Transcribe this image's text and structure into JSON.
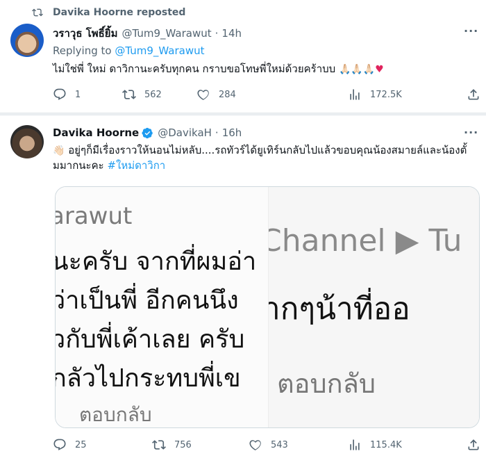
{
  "retweet_tweet": {
    "repost_label": "Davika Hoorne reposted",
    "author_name": "วราวุธ โพธิ์ยิ้ม",
    "author_handle": "@Tum9_Warawut",
    "time": "14h",
    "replying_prefix": "Replying to",
    "replying_handle": "@Tum9_Warawut",
    "text": "ไม่ใช่พี่ ใหม่ ดาวิกานะครับทุกคน กราบขอโทษพี่ใหม่ด้วยคร้าบบ",
    "emoji_hands": "🙏🏻🙏🏻🙏🏻",
    "emoji_heart": "♥",
    "stats": {
      "replies": "1",
      "reposts": "562",
      "likes": "284",
      "views": "172.5K"
    }
  },
  "main_tweet": {
    "author_name": "Davika Hoorne",
    "author_handle": "@DavikaH",
    "time": "16h",
    "emoji_lead": "👋🏻",
    "text": "อยู่ๆก็มีเรื่องราวให้นอนไม่หลับ....รถทัวร์ได้ยูเทิร์นกลับไปแล้วขอบคุณน้องสมายล์และน้องตั้มมากนะคะ",
    "hashtag": "#ใหม่ดาวิกา",
    "media_left": {
      "username": "arawut",
      "line1": "นะครับ จากที่ผมอ่า",
      "line2": "ว่าเป็นพี่ อีกคนนึง",
      "line3": "วกับพี่เค้าเลย ครับ",
      "line4": "กลัวไปกระทบพี่เข",
      "reply": "ตอบกลับ"
    },
    "media_right": {
      "channel": "Channel ▶ Tu",
      "text": "ากๆน้าที่ออ",
      "reply": "ตอบกลับ"
    },
    "stats": {
      "replies": "25",
      "reposts": "756",
      "likes": "543",
      "views": "115.4K"
    }
  },
  "colors": {
    "accent": "#1d9bf0",
    "muted": "#536471",
    "heart": "#e0245e"
  }
}
